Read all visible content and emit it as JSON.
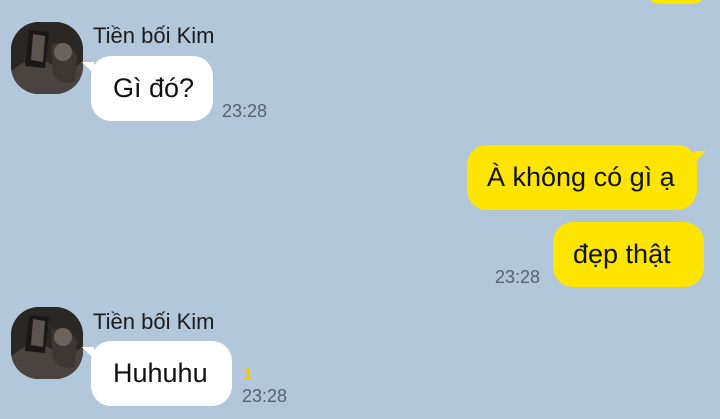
{
  "messages": [
    {
      "side": "in",
      "sender": "Tiền bối Kim",
      "text": "Gì đó?",
      "time": "23:28"
    },
    {
      "side": "out",
      "text": "À không có gì ạ"
    },
    {
      "side": "out",
      "text": "đẹp thật",
      "time": "23:28"
    },
    {
      "side": "in",
      "sender": "Tiền bối Kim",
      "text": "Huhuhu",
      "unread": "1",
      "time": "23:28"
    }
  ],
  "colors": {
    "background": "#b2c7da",
    "outgoing_bubble": "#fee500",
    "incoming_bubble": "#ffffff",
    "unread_count": "#f2c900"
  }
}
